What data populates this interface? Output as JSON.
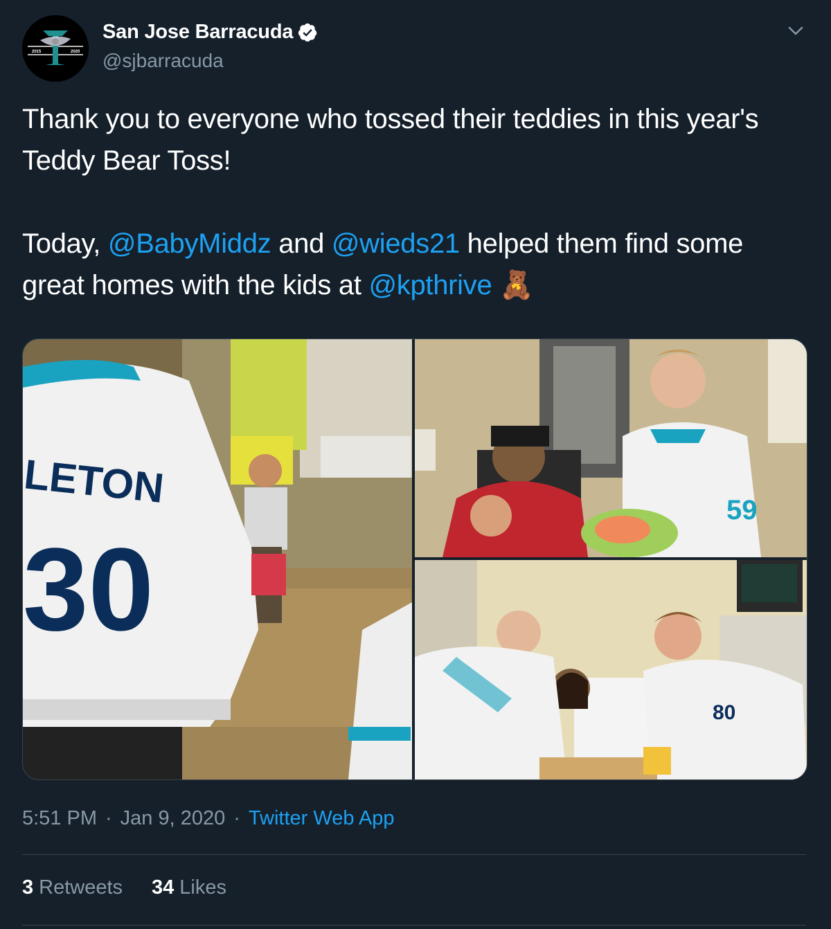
{
  "author": {
    "display_name": "San Jose Barracuda",
    "handle": "@sjbarracuda",
    "verified": true,
    "avatar_years": [
      "2015",
      "2020"
    ]
  },
  "tweet": {
    "line1": "Thank you to everyone who tossed their teddies in this year's Teddy Bear Toss!",
    "line2_before": "Today, ",
    "mention1": "@BabyMiddz",
    "line2_mid": " and ",
    "mention2": "@wieds21",
    "line2_after": " helped them find some great homes with the kids at ",
    "mention3": "@kpthrive",
    "emoji": "🧸"
  },
  "media": {
    "photo_count": 3
  },
  "meta": {
    "time": "5:51 PM",
    "separator": "·",
    "date": "Jan 9, 2020",
    "source": "Twitter Web App"
  },
  "stats": {
    "retweets_count": "3",
    "retweets_label": "Retweets",
    "likes_count": "34",
    "likes_label": "Likes"
  },
  "colors": {
    "background": "#15202b",
    "link": "#1da1f2",
    "secondary_text": "#8899a6",
    "divider": "#38444d"
  },
  "icons": [
    "team-logo-avatar",
    "verified-badge-icon",
    "chevron-down-icon",
    "teddy-bear-emoji"
  ]
}
